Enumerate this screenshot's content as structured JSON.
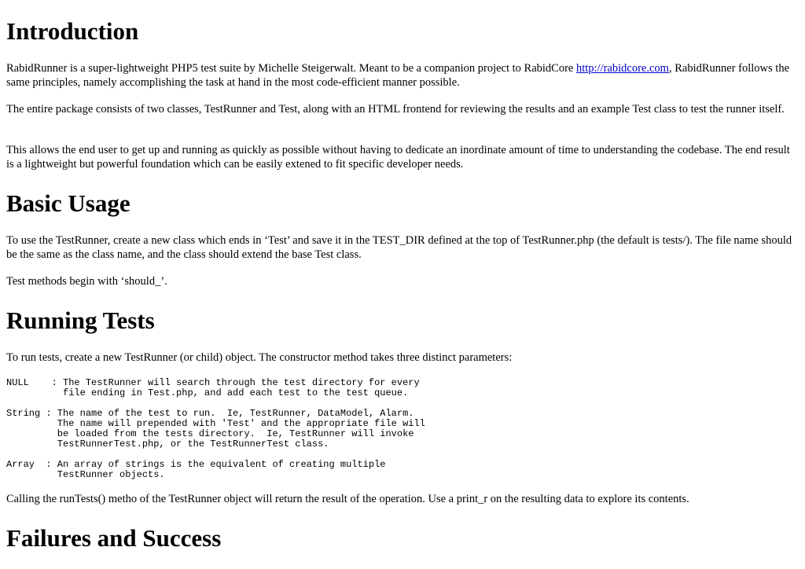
{
  "intro": {
    "heading": "Introduction",
    "p1_before_link": "RabidRunner is a super-lightweight PHP5 test suite by Michelle Steigerwalt. Meant to be a companion project to RabidCore ",
    "p1_link": "http://rabidcore.com",
    "p1_after_link": ", RabidRunner follows the same principles, namely accomplishing the task at hand in the most code-efficient manner possible.",
    "p2": "The entire package consists of two classes, TestRunner and Test, along with an HTML frontend for reviewing the results and an example Test class to test the runner itself.",
    "p3": "This allows the end user to get up and running as quickly as possible without having to dedicate an inordinate amount of time to understanding the codebase. The end result is a lightweight but powerful foundation which can be easily extened to fit specific developer needs."
  },
  "basic_usage": {
    "heading": "Basic Usage",
    "p1": "To use the TestRunner, create a new class which ends in ‘Test’ and save it in the TEST_DIR defined at the top of TestRunner.php (the default is tests/). The file name should be the same as the class name, and the class should extend the base Test class.",
    "p2": "Test methods begin with ‘should_’."
  },
  "running_tests": {
    "heading": "Running Tests",
    "p1": "To run tests, create a new TestRunner (or child) object. The constructor method takes three distinct parameters:",
    "param_null": "NULL    : The TestRunner will search through the test directory for every\n          file ending in Test.php, and add each test to the test queue.",
    "param_string": "String : The name of the test to run.  Ie, TestRunner, DataModel, Alarm.\n         The name will prepended with 'Test' and the appropriate file will\n         be loaded from the tests directory.  Ie, TestRunner will invoke\n         TestRunnerTest.php, or the TestRunnerTest class.",
    "param_array": "Array  : An array of strings is the equivalent of creating multiple\n         TestRunner objects.",
    "p2": "Calling the runTests() metho of the TestRunner object will return the result of the operation. Use a print_r on the resulting data to explore its contents."
  },
  "failures": {
    "heading": "Failures and Success"
  }
}
